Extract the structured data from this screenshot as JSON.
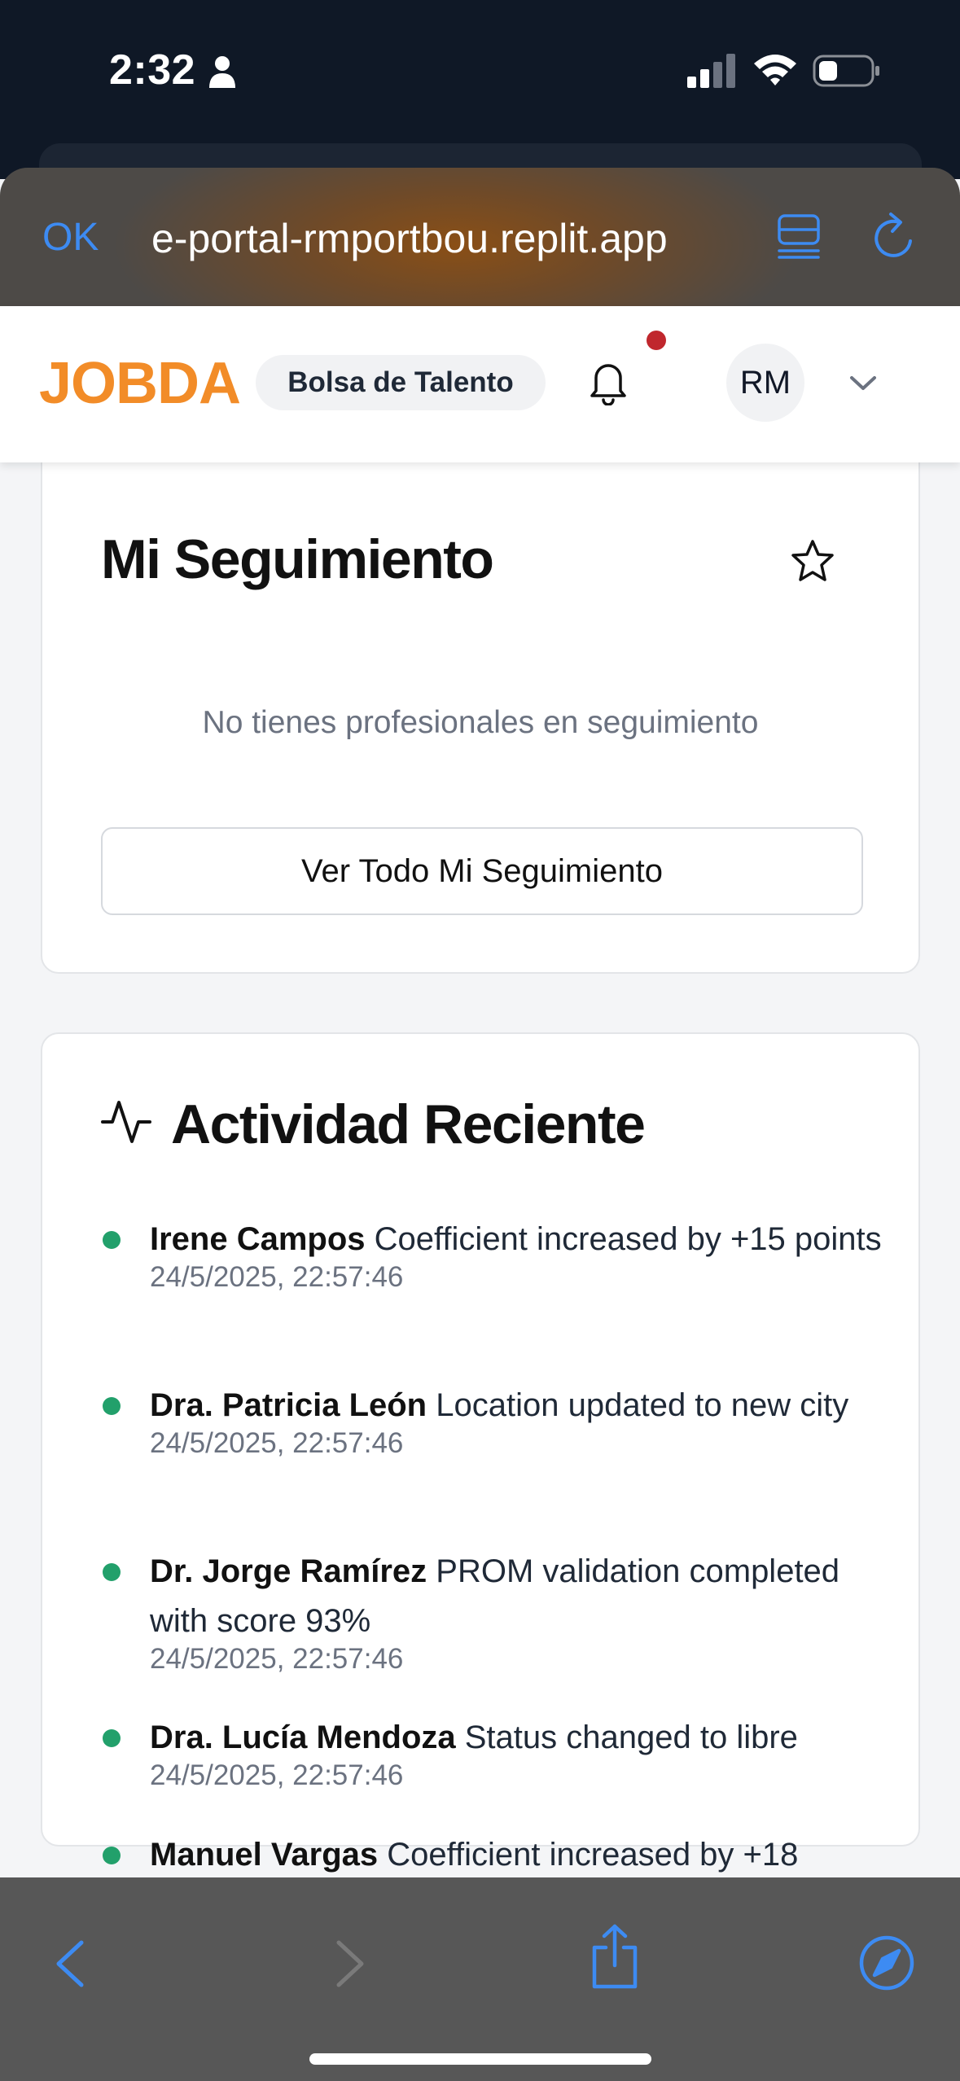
{
  "status_bar": {
    "time": "2:32"
  },
  "browser": {
    "ok_label": "OK",
    "url": "e-portal-rmportbou.replit.app"
  },
  "header": {
    "logo": "JOBDA",
    "section_badge": "Bolsa de Talento",
    "avatar_initials": "RM",
    "has_notification": true
  },
  "follow_card": {
    "title": "Mi Seguimiento",
    "empty_message": "No tienes profesionales en seguimiento",
    "view_all_label": "Ver Todo Mi Seguimiento"
  },
  "activity_card": {
    "title": "Actividad Reciente",
    "items": [
      {
        "name": "Irene Campos",
        "text": "Coefficient increased by +15 points",
        "time": "24/5/2025, 22:57:46"
      },
      {
        "name": "Dra. Patricia León",
        "text": "Location updated to new city",
        "time": "24/5/2025, 22:57:46"
      },
      {
        "name": "Dr. Jorge Ramírez",
        "text": "PROM validation completed with score 93%",
        "time": "24/5/2025, 22:57:46"
      },
      {
        "name": "Dra. Lucía Mendoza",
        "text": "Status changed to libre",
        "time": "24/5/2025, 22:57:46"
      },
      {
        "name": "Manuel Vargas",
        "text": "Coefficient increased by +18",
        "time": ""
      }
    ]
  },
  "colors": {
    "brand_orange": "#f28c28",
    "safari_blue": "#3d8bf2",
    "activity_dot_green": "#22a06b",
    "notification_red": "#c0272d"
  }
}
